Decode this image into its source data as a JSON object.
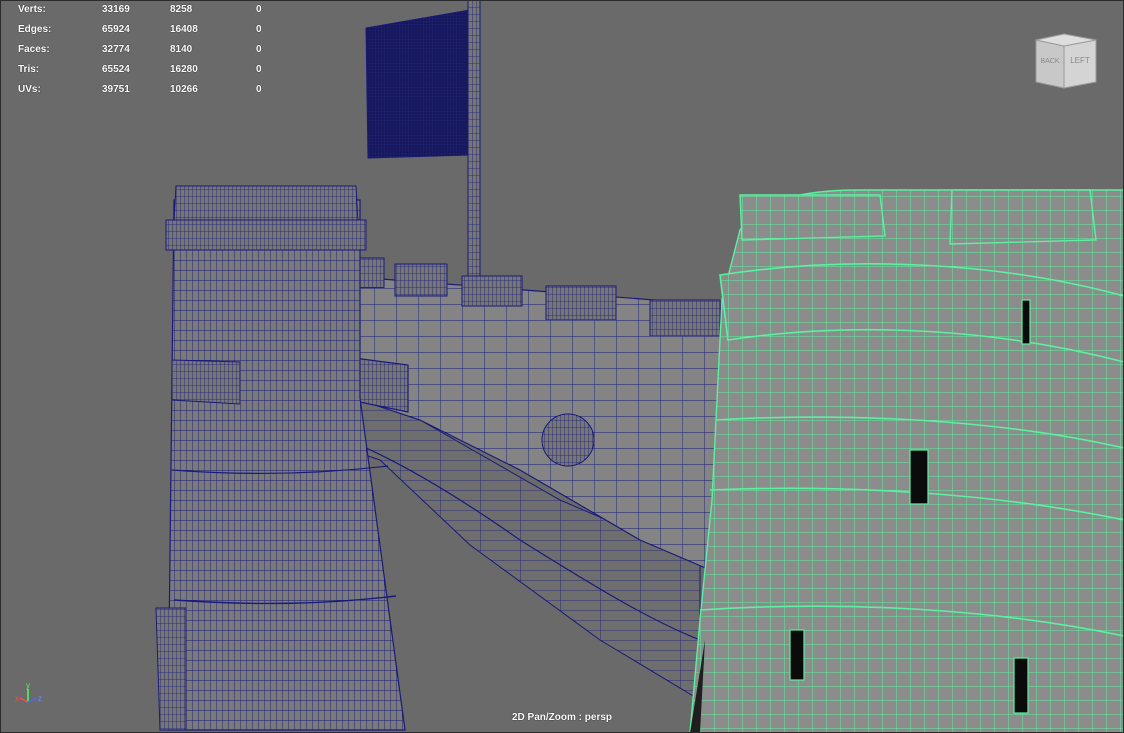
{
  "hud": {
    "rows": [
      {
        "label": "Verts:",
        "a": "33169",
        "b": "8258",
        "c": "0"
      },
      {
        "label": "Edges:",
        "a": "65924",
        "b": "16408",
        "c": "0"
      },
      {
        "label": "Faces:",
        "a": "32774",
        "b": "8140",
        "c": "0"
      },
      {
        "label": "Tris:",
        "a": "65524",
        "b": "16280",
        "c": "0"
      },
      {
        "label": "UVs:",
        "a": "39751",
        "b": "10266",
        "c": "0"
      }
    ]
  },
  "viewcube": {
    "back": "BACK",
    "left": "LEFT"
  },
  "axis": {
    "x": "x",
    "y": "y",
    "z": "z"
  },
  "camera_label": "2D Pan/Zoom : persp",
  "colors": {
    "background": "#6a6a6a",
    "wire_unselected": "#1a1a7a",
    "wire_selected": "#5cf0a0",
    "flag": "#16175a"
  }
}
